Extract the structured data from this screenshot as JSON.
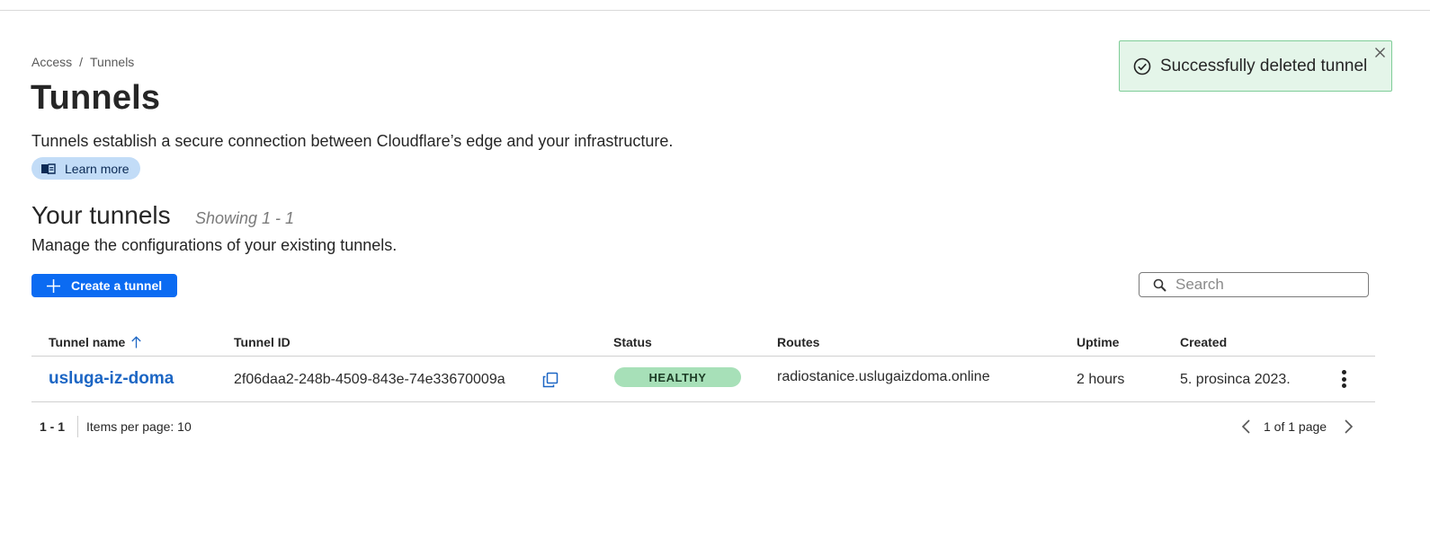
{
  "breadcrumb": {
    "items": [
      "Access",
      "Tunnels"
    ],
    "separator": "/"
  },
  "page": {
    "title": "Tunnels",
    "description": "Tunnels establish a secure connection between Cloudflare’s edge and your infrastructure.",
    "learn_more": "Learn more",
    "learn_more_icon": "book-icon"
  },
  "section": {
    "title": "Your tunnels",
    "count": "Showing 1 - 1",
    "description": "Manage the configurations of your existing tunnels."
  },
  "actions": {
    "create_label": "Create a tunnel",
    "create_icon": "plus-icon",
    "search_placeholder": "Search",
    "search_value": ""
  },
  "table": {
    "headers": {
      "name": "Tunnel name",
      "id": "Tunnel ID",
      "status": "Status",
      "routes": "Routes",
      "uptime": "Uptime",
      "created": "Created"
    },
    "sort": {
      "column": "Tunnel name",
      "direction": "ascending"
    },
    "rows": [
      {
        "name": "usluga-iz-doma",
        "id": "2f06daa2-248b-4509-843e-74e33670009a",
        "status": "HEALTHY",
        "routes": "radiostanice.uslugaizdoma.online",
        "uptime": "2 hours",
        "created": "5. prosinca 2023."
      }
    ]
  },
  "pagination": {
    "range": "1 - 1",
    "items_per_page": "Items per page: 10",
    "pages": "1 of 1 page"
  },
  "toast": {
    "message": "Successfully deleted tunnel",
    "type": "success"
  },
  "colors": {
    "primary": "#0b6bf2",
    "link": "#1c66c4",
    "healthy_bg": "#a7e0b8",
    "toast_bg": "#e4f5e9",
    "toast_border": "#7fcd98",
    "learn_more_bg": "#c2dcf7"
  }
}
